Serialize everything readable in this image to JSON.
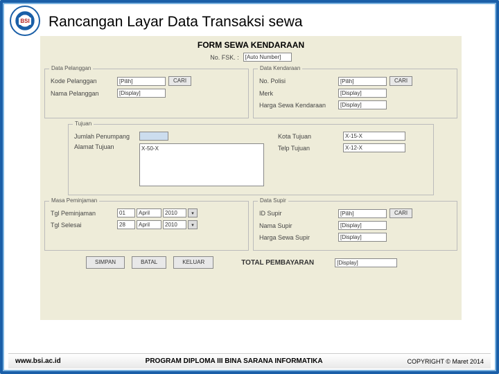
{
  "page_title": "Rancangan Layar Data Transaksi sewa",
  "logo_text": "BSI",
  "form": {
    "title": "FORM SEWA KENDARAAN",
    "no_fsk_label": "No. FSK.   :",
    "no_fsk_value": "[Auto Number]"
  },
  "pelanggan": {
    "title": "Data Pelanggan",
    "kode_label": "Kode Pelanggan",
    "kode_value": "[Pilih]",
    "cari": "CARI",
    "nama_label": "Nama Pelanggan",
    "nama_value": "[Display]"
  },
  "kendaraan": {
    "title": "Data Kendaraan",
    "nopol_label": "No. Polisi",
    "nopol_value": "[Pilih]",
    "cari": "CARI",
    "merk_label": "Merk",
    "merk_value": "[Display]",
    "harga_label": "Harga Sewa Kendaraan",
    "harga_value": "[Display]"
  },
  "tujuan": {
    "title": "Tujuan",
    "jml_label": "Jumlah Penumpang",
    "jml_value": "",
    "alamat_label": "Alamat Tujuan",
    "alamat_value": "X-50-X",
    "kota_label": "Kota Tujuan",
    "kota_value": "X-15-X",
    "telp_label": "Telp Tujuan",
    "telp_value": "X-12-X"
  },
  "masa": {
    "title": "Masa Peminjaman",
    "tgl_pinjam_label": "Tgl Peminjaman",
    "tgl_pinjam": {
      "d": "01",
      "m": "April",
      "y": "2010"
    },
    "tgl_selesai_label": "Tgl Selesai",
    "tgl_selesai": {
      "d": "28",
      "m": "April",
      "y": "2010"
    }
  },
  "supir": {
    "title": "Data Supir",
    "id_label": "ID Supir",
    "id_value": "[Pilih]",
    "cari": "CARI",
    "nama_label": "Nama Supir",
    "nama_value": "[Display]",
    "harga_label": "Harga Sewa Supir",
    "harga_value": "[Display]"
  },
  "total": {
    "label": "TOTAL PEMBAYARAN",
    "value": "[Display]"
  },
  "buttons": {
    "simpan": "SIMPAN",
    "batal": "BATAL",
    "keluar": "KELUAR"
  },
  "footer": {
    "left": "www.bsi.ac.id",
    "center": "PROGRAM DIPLOMA III BINA SARANA INFORMATIKA",
    "right": "COPYRIGHT © Maret 2014"
  }
}
